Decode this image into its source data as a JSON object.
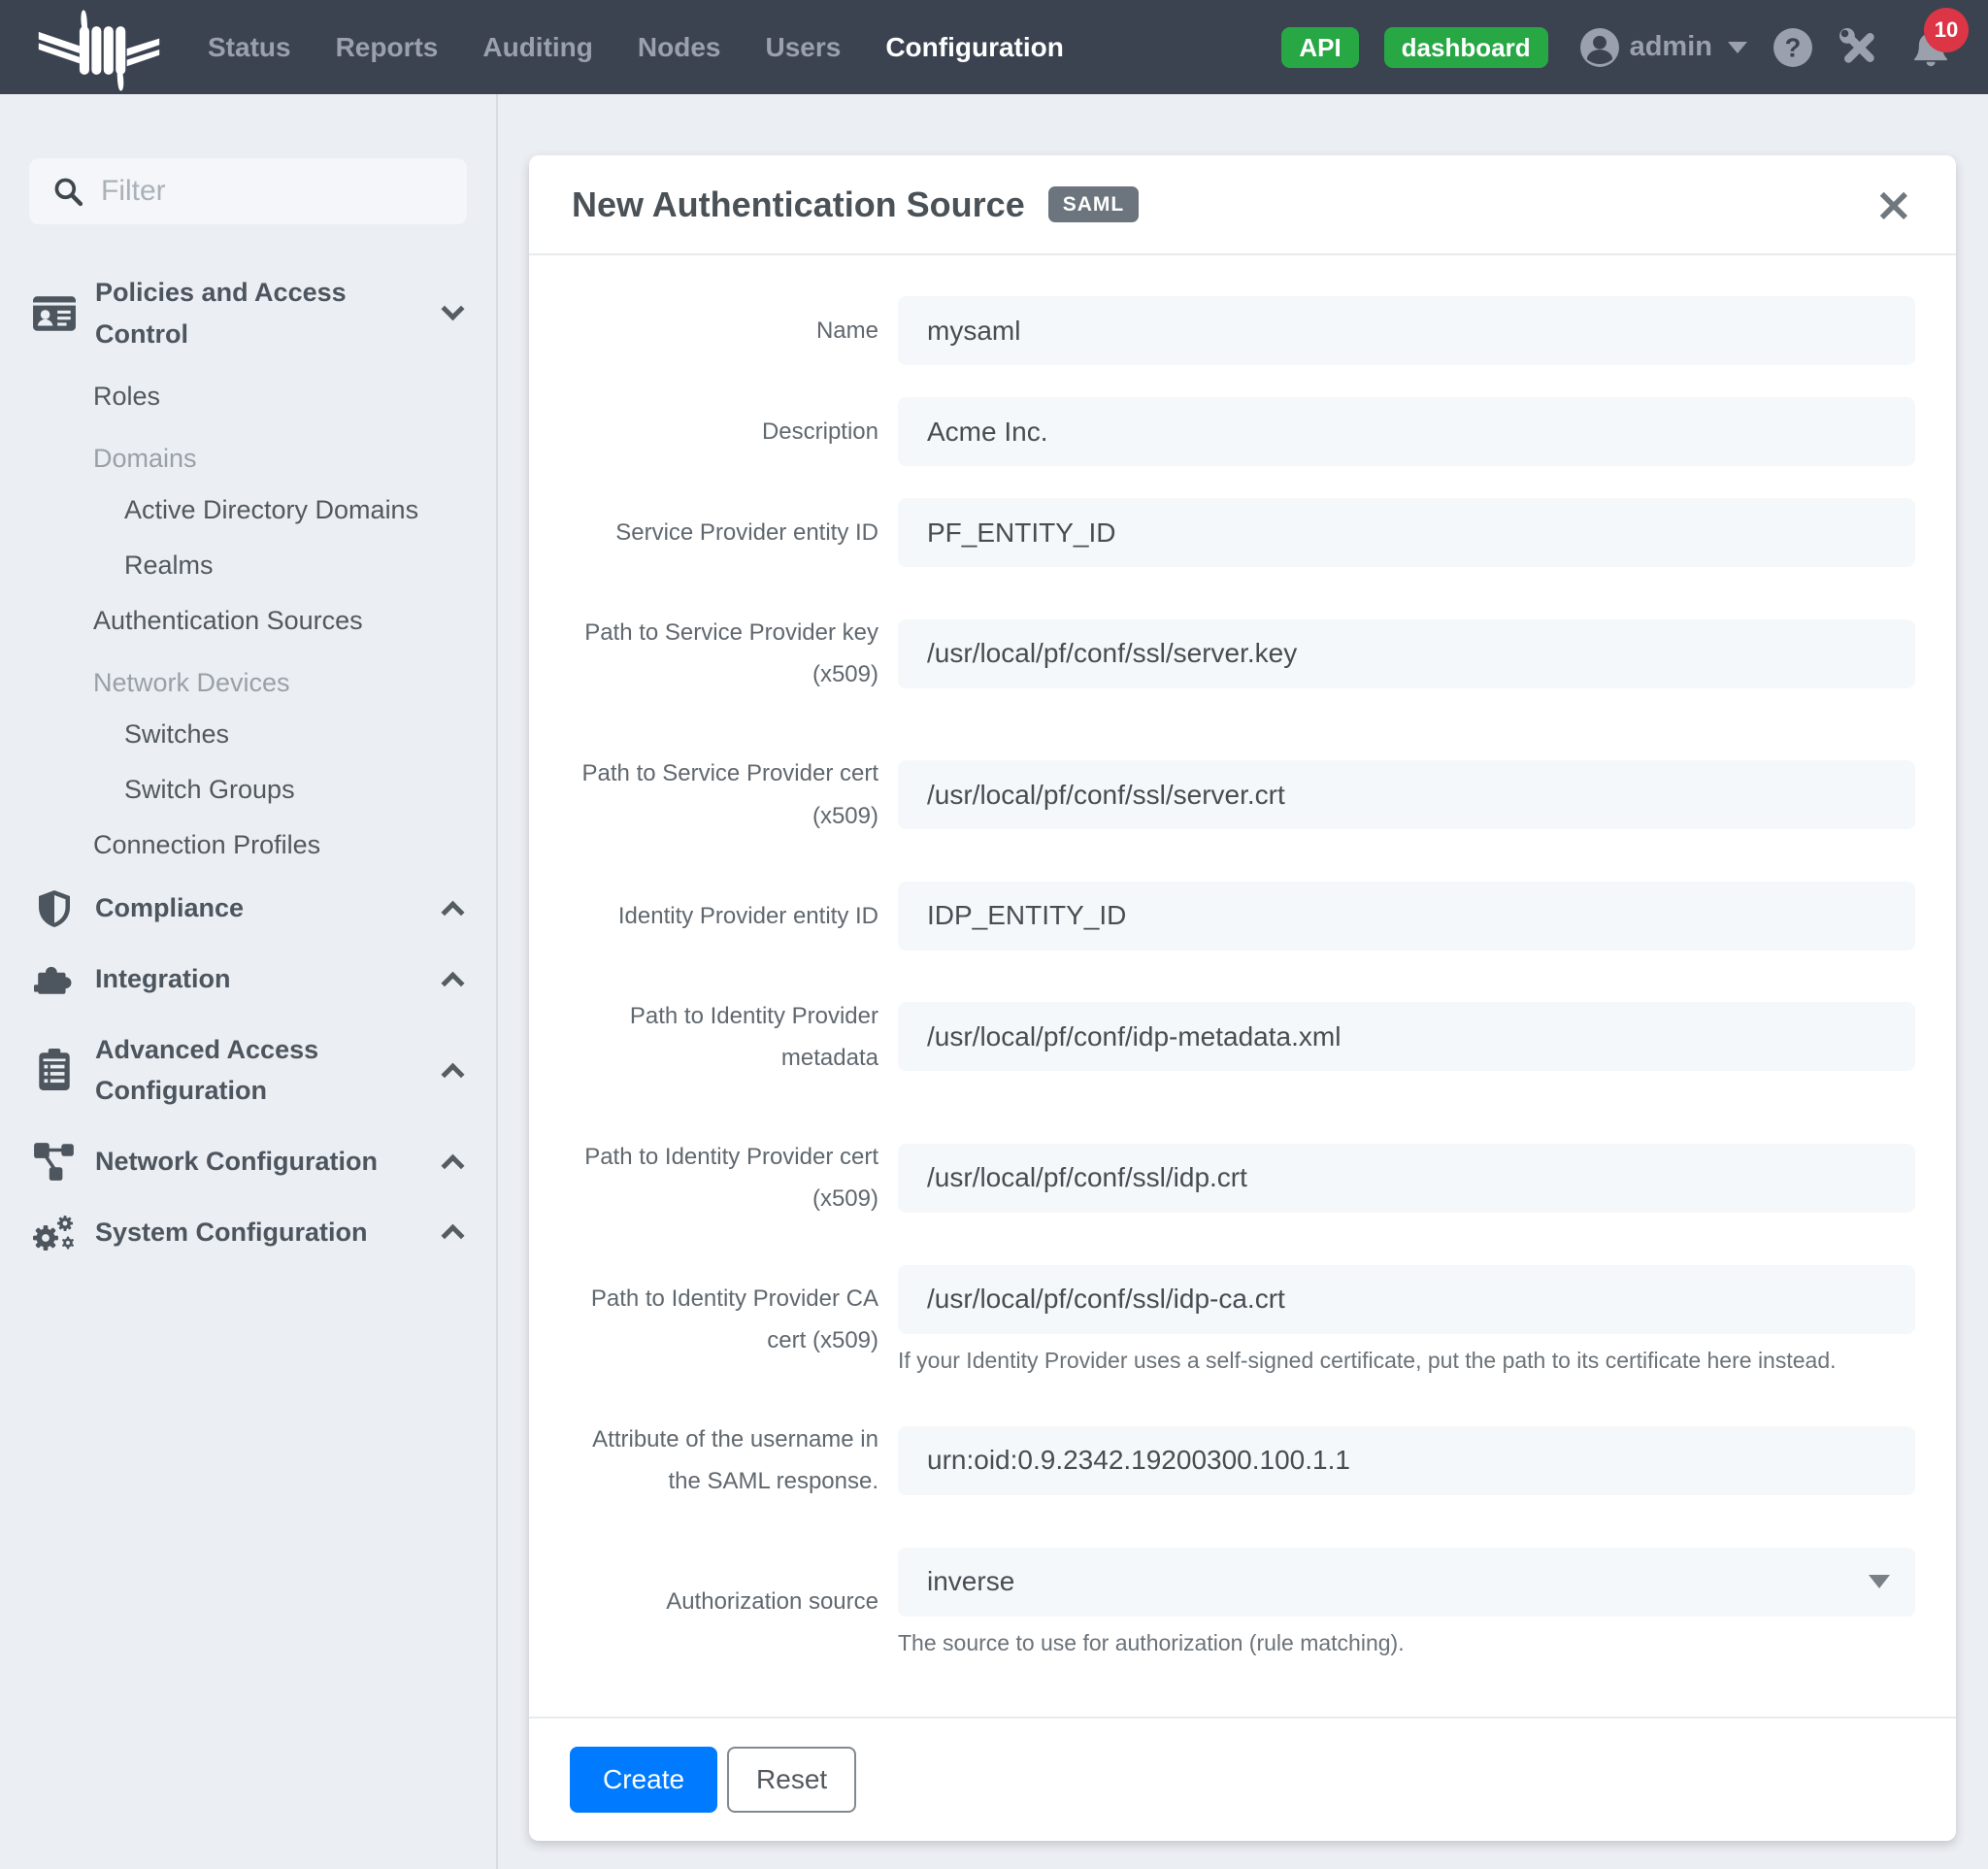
{
  "colors": {
    "navbar": "#3b4351",
    "accent": "#007bff",
    "success": "#28a745",
    "danger": "#dc3545"
  },
  "navbar": {
    "logo_icon": "packetfence-barbed-wire-logo",
    "items": [
      {
        "label": "Status"
      },
      {
        "label": "Reports"
      },
      {
        "label": "Auditing"
      },
      {
        "label": "Nodes"
      },
      {
        "label": "Users"
      },
      {
        "label": "Configuration"
      }
    ],
    "active_item": "Configuration",
    "badges": {
      "api": "API",
      "dashboard": "dashboard"
    },
    "user": "admin",
    "right_icons": [
      "person-icon",
      "caret-down-icon",
      "help-icon",
      "tools-icon",
      "bell-icon"
    ],
    "notification_count": "10"
  },
  "sidebar": {
    "filter_placeholder": "Filter",
    "filter_icon": "search-icon",
    "items": [
      {
        "type": "item",
        "label": "Policies and Access Control",
        "icon": "id-card",
        "chevron": "down"
      },
      {
        "type": "link",
        "label": "Roles",
        "indent": 1
      },
      {
        "type": "heading",
        "label": "Domains"
      },
      {
        "type": "link",
        "label": "Active Directory Domains",
        "indent": 2
      },
      {
        "type": "link",
        "label": "Realms",
        "indent": 2
      },
      {
        "type": "link",
        "label": "Authentication Sources",
        "indent": 1
      },
      {
        "type": "heading",
        "label": "Network Devices"
      },
      {
        "type": "link",
        "label": "Switches",
        "indent": 2
      },
      {
        "type": "link",
        "label": "Switch Groups",
        "indent": 2
      },
      {
        "type": "link",
        "label": "Connection Profiles",
        "indent": 1
      },
      {
        "type": "item",
        "label": "Compliance",
        "icon": "shield",
        "chevron": "up"
      },
      {
        "type": "item",
        "label": "Integration",
        "icon": "puzzle",
        "chevron": "up"
      },
      {
        "type": "item",
        "label": "Advanced Access Configuration",
        "icon": "clipboard",
        "chevron": "up"
      },
      {
        "type": "item",
        "label": "Network Configuration",
        "icon": "sitemap",
        "chevron": "up"
      },
      {
        "type": "item",
        "label": "System Configuration",
        "icon": "gears",
        "chevron": "up"
      }
    ]
  },
  "modal": {
    "title": "New Authentication Source",
    "badge": "SAML",
    "close_icon": "×",
    "fields": [
      {
        "label": "Name",
        "value": "mysaml",
        "type": "text"
      },
      {
        "label": "Description",
        "value": "Acme Inc.",
        "type": "text"
      },
      {
        "label": "Service Provider entity ID",
        "value": "PF_ENTITY_ID",
        "type": "text"
      },
      {
        "label": "Path to Service Provider key (x509)",
        "value": "/usr/local/pf/conf/ssl/server.key",
        "type": "text"
      },
      {
        "label": "Path to Service Provider cert (x509)",
        "value": "/usr/local/pf/conf/ssl/server.crt",
        "type": "text"
      },
      {
        "label": "Identity Provider entity ID",
        "value": "IDP_ENTITY_ID",
        "type": "text"
      },
      {
        "label": "Path to Identity Provider metadata",
        "value": "/usr/local/pf/conf/idp-metadata.xml",
        "type": "text"
      },
      {
        "label": "Path to Identity Provider cert (x509)",
        "value": "/usr/local/pf/conf/ssl/idp.crt",
        "type": "text"
      },
      {
        "label": "Path to Identity Provider CA cert (x509)",
        "value": "/usr/local/pf/conf/ssl/idp-ca.crt",
        "type": "text",
        "help": "If your Identity Provider uses a self-signed certificate, put the path to its certificate here instead."
      },
      {
        "label": "Attribute of the username in the SAML response.",
        "value": "urn:oid:0.9.2342.19200300.100.1.1",
        "type": "text"
      },
      {
        "label": "Authorization source",
        "value": "inverse",
        "type": "select",
        "help": "The source to use for authorization (rule matching)."
      }
    ],
    "buttons": {
      "create": "Create",
      "reset": "Reset"
    }
  }
}
